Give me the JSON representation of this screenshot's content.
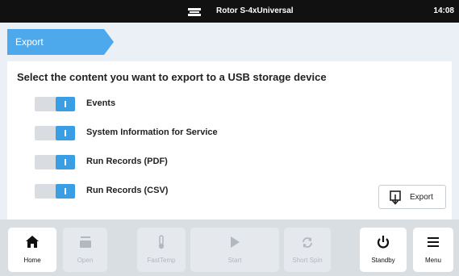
{
  "statusbar": {
    "rotor_icon": "rotor-icon",
    "rotor_name": "Rotor S-4xUniversal",
    "time": "14:08"
  },
  "breadcrumb": {
    "label": "Export"
  },
  "content": {
    "title": "Select the content you want to export to a USB storage device",
    "options": [
      {
        "label": "Events",
        "on": true
      },
      {
        "label": "System Information for Service",
        "on": true
      },
      {
        "label": "Run Records (PDF)",
        "on": true
      },
      {
        "label": "Run Records (CSV)",
        "on": true
      }
    ],
    "export_button": {
      "label": "Export",
      "icon": "export-usb-icon"
    }
  },
  "bottom_nav": [
    {
      "label": "Home",
      "icon": "home-icon",
      "enabled": true
    },
    {
      "label": "Open",
      "icon": "lid-open-icon",
      "enabled": false
    },
    {
      "label": "FastTemp",
      "icon": "thermometer-icon",
      "enabled": false
    },
    {
      "label": "Start",
      "icon": "play-icon",
      "enabled": false
    },
    {
      "label": "Short Spin",
      "icon": "refresh-icon",
      "enabled": false
    },
    {
      "label": "Standby",
      "icon": "power-icon",
      "enabled": true
    },
    {
      "label": "Menu",
      "icon": "menu-icon",
      "enabled": true
    }
  ],
  "colors": {
    "accent": "#3a9ee4",
    "breadcrumb": "#4ea9ec",
    "statusbar": "#111111",
    "background": "#eaf0f6"
  }
}
